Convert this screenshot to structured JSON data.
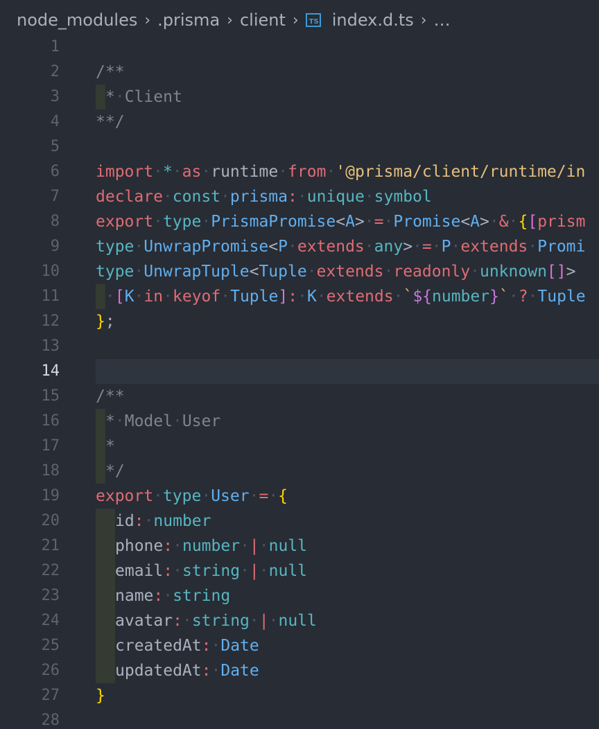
{
  "breadcrumb": {
    "items": [
      "node_modules",
      ".prisma",
      "client"
    ],
    "file_icon": "TS",
    "file_name": "index.d.ts",
    "more": "…"
  },
  "editor": {
    "current_line": 14,
    "lines": [
      {
        "n": "1",
        "tokens": []
      },
      {
        "n": "2",
        "tokens": [
          [
            "cm",
            "/**"
          ]
        ]
      },
      {
        "n": "3",
        "tokens": [
          [
            "ind",
            ""
          ],
          [
            "cm",
            "*"
          ],
          [
            "ws",
            "·"
          ],
          [
            "cm",
            "Client"
          ]
        ]
      },
      {
        "n": "4",
        "tokens": [
          [
            "cm",
            "**/"
          ]
        ]
      },
      {
        "n": "5",
        "tokens": []
      },
      {
        "n": "6",
        "tokens": [
          [
            "kw",
            "import"
          ],
          [
            "ws",
            "·"
          ],
          [
            "kw2",
            "*"
          ],
          [
            "ws",
            "·"
          ],
          [
            "kw",
            "as"
          ],
          [
            "ws",
            "·"
          ],
          [
            "id",
            "runtime"
          ],
          [
            "ws",
            "·"
          ],
          [
            "kw",
            "from"
          ],
          [
            "ws",
            "·"
          ],
          [
            "str",
            "'@prisma/client/runtime/in"
          ]
        ]
      },
      {
        "n": "7",
        "tokens": [
          [
            "kw",
            "declare"
          ],
          [
            "ws",
            "·"
          ],
          [
            "kw2",
            "const"
          ],
          [
            "ws",
            "·"
          ],
          [
            "ty",
            "prisma"
          ],
          [
            "op",
            ":"
          ],
          [
            "ws",
            "·"
          ],
          [
            "kw2",
            "unique"
          ],
          [
            "ws",
            "·"
          ],
          [
            "kw2",
            "symbol"
          ]
        ]
      },
      {
        "n": "8",
        "tokens": [
          [
            "kw",
            "export"
          ],
          [
            "ws",
            "·"
          ],
          [
            "kw2",
            "type"
          ],
          [
            "ws",
            "·"
          ],
          [
            "ty",
            "PrismaPromise"
          ],
          [
            "pl",
            "<"
          ],
          [
            "ty",
            "A"
          ],
          [
            "pl",
            ">"
          ],
          [
            "ws",
            "·"
          ],
          [
            "op",
            "="
          ],
          [
            "ws",
            "·"
          ],
          [
            "ty",
            "Promise"
          ],
          [
            "pl",
            "<"
          ],
          [
            "ty",
            "A"
          ],
          [
            "pl",
            ">"
          ],
          [
            "ws",
            "·"
          ],
          [
            "op",
            "&"
          ],
          [
            "ws",
            "·"
          ],
          [
            "br",
            "{"
          ],
          [
            "br2",
            "["
          ],
          [
            "kw",
            "prism"
          ]
        ]
      },
      {
        "n": "9",
        "tokens": [
          [
            "kw2",
            "type"
          ],
          [
            "ws",
            "·"
          ],
          [
            "ty",
            "UnwrapPromise"
          ],
          [
            "pl",
            "<"
          ],
          [
            "ty",
            "P"
          ],
          [
            "ws",
            "·"
          ],
          [
            "kw",
            "extends"
          ],
          [
            "ws",
            "·"
          ],
          [
            "kw2",
            "any"
          ],
          [
            "pl",
            ">"
          ],
          [
            "ws",
            "·"
          ],
          [
            "op",
            "="
          ],
          [
            "ws",
            "·"
          ],
          [
            "ty",
            "P"
          ],
          [
            "ws",
            "·"
          ],
          [
            "kw",
            "extends"
          ],
          [
            "ws",
            "·"
          ],
          [
            "ty",
            "Promi"
          ]
        ]
      },
      {
        "n": "10",
        "tokens": [
          [
            "kw2",
            "type"
          ],
          [
            "ws",
            "·"
          ],
          [
            "ty",
            "UnwrapTuple"
          ],
          [
            "pl",
            "<"
          ],
          [
            "ty",
            "Tuple"
          ],
          [
            "ws",
            "·"
          ],
          [
            "kw",
            "extends"
          ],
          [
            "ws",
            "·"
          ],
          [
            "kw",
            "readonly"
          ],
          [
            "ws",
            "·"
          ],
          [
            "kw2",
            "unknown"
          ],
          [
            "br2",
            "[]"
          ],
          [
            "pl",
            ">"
          ]
        ]
      },
      {
        "n": "11",
        "tokens": [
          [
            "ind",
            ""
          ],
          [
            "ws",
            "·"
          ],
          [
            "br2",
            "["
          ],
          [
            "ty",
            "K"
          ],
          [
            "ws",
            "·"
          ],
          [
            "kw",
            "in"
          ],
          [
            "ws",
            "·"
          ],
          [
            "kw",
            "keyof"
          ],
          [
            "ws",
            "·"
          ],
          [
            "ty",
            "Tuple"
          ],
          [
            "br2",
            "]"
          ],
          [
            "op",
            ":"
          ],
          [
            "ws",
            "·"
          ],
          [
            "ty",
            "K"
          ],
          [
            "ws",
            "·"
          ],
          [
            "kw",
            "extends"
          ],
          [
            "ws",
            "·"
          ],
          [
            "tpl",
            "`"
          ],
          [
            "tplx",
            "${"
          ],
          [
            "kw2",
            "number"
          ],
          [
            "tplx",
            "}"
          ],
          [
            "tpl",
            "`"
          ],
          [
            "ws",
            "·"
          ],
          [
            "op",
            "?"
          ],
          [
            "ws",
            "·"
          ],
          [
            "ty",
            "Tuple"
          ]
        ]
      },
      {
        "n": "12",
        "tokens": [
          [
            "br",
            "}"
          ],
          [
            "pl",
            ";"
          ]
        ]
      },
      {
        "n": "13",
        "tokens": []
      },
      {
        "n": "14",
        "tokens": []
      },
      {
        "n": "15",
        "tokens": [
          [
            "cm",
            "/**"
          ]
        ]
      },
      {
        "n": "16",
        "tokens": [
          [
            "ind",
            ""
          ],
          [
            "cm",
            "*"
          ],
          [
            "ws",
            "·"
          ],
          [
            "cm",
            "Model"
          ],
          [
            "ws",
            "·"
          ],
          [
            "cm",
            "User"
          ]
        ]
      },
      {
        "n": "17",
        "tokens": [
          [
            "ind",
            ""
          ],
          [
            "cm",
            "*"
          ]
        ]
      },
      {
        "n": "18",
        "tokens": [
          [
            "ind",
            ""
          ],
          [
            "cm",
            "*/"
          ]
        ]
      },
      {
        "n": "19",
        "tokens": [
          [
            "kw",
            "export"
          ],
          [
            "ws",
            "·"
          ],
          [
            "kw2",
            "type"
          ],
          [
            "ws",
            "·"
          ],
          [
            "ty",
            "User"
          ],
          [
            "ws",
            "·"
          ],
          [
            "op",
            "="
          ],
          [
            "ws",
            "·"
          ],
          [
            "br",
            "{"
          ]
        ]
      },
      {
        "n": "20",
        "tokens": [
          [
            "ind2",
            ""
          ],
          [
            "prop",
            "id"
          ],
          [
            "op",
            ":"
          ],
          [
            "ws",
            "·"
          ],
          [
            "kw2",
            "number"
          ]
        ]
      },
      {
        "n": "21",
        "tokens": [
          [
            "ind2",
            ""
          ],
          [
            "prop",
            "phone"
          ],
          [
            "op",
            ":"
          ],
          [
            "ws",
            "·"
          ],
          [
            "kw2",
            "number"
          ],
          [
            "ws",
            "·"
          ],
          [
            "op",
            "|"
          ],
          [
            "ws",
            "·"
          ],
          [
            "kw2",
            "null"
          ]
        ]
      },
      {
        "n": "22",
        "tokens": [
          [
            "ind2",
            ""
          ],
          [
            "prop",
            "email"
          ],
          [
            "op",
            ":"
          ],
          [
            "ws",
            "·"
          ],
          [
            "kw2",
            "string"
          ],
          [
            "ws",
            "·"
          ],
          [
            "op",
            "|"
          ],
          [
            "ws",
            "·"
          ],
          [
            "kw2",
            "null"
          ]
        ]
      },
      {
        "n": "23",
        "tokens": [
          [
            "ind2",
            ""
          ],
          [
            "prop",
            "name"
          ],
          [
            "op",
            ":"
          ],
          [
            "ws",
            "·"
          ],
          [
            "kw2",
            "string"
          ]
        ]
      },
      {
        "n": "24",
        "tokens": [
          [
            "ind2",
            ""
          ],
          [
            "prop",
            "avatar"
          ],
          [
            "op",
            ":"
          ],
          [
            "ws",
            "·"
          ],
          [
            "kw2",
            "string"
          ],
          [
            "ws",
            "·"
          ],
          [
            "op",
            "|"
          ],
          [
            "ws",
            "·"
          ],
          [
            "kw2",
            "null"
          ]
        ]
      },
      {
        "n": "25",
        "tokens": [
          [
            "ind2",
            ""
          ],
          [
            "prop",
            "createdAt"
          ],
          [
            "op",
            ":"
          ],
          [
            "ws",
            "·"
          ],
          [
            "ty",
            "Date"
          ]
        ]
      },
      {
        "n": "26",
        "tokens": [
          [
            "ind2",
            ""
          ],
          [
            "prop",
            "updatedAt"
          ],
          [
            "op",
            ":"
          ],
          [
            "ws",
            "·"
          ],
          [
            "ty",
            "Date"
          ]
        ]
      },
      {
        "n": "27",
        "tokens": [
          [
            "br",
            "}"
          ]
        ]
      },
      {
        "n": "28",
        "tokens": []
      }
    ]
  }
}
